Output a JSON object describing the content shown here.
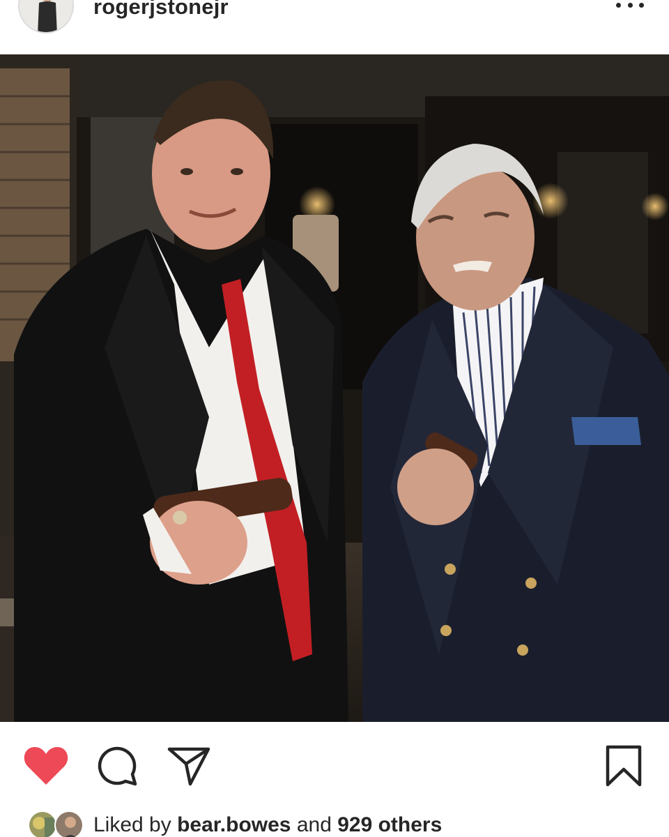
{
  "header": {
    "username": "rogerjstonejr",
    "more_icon": "more-horizontal-icon"
  },
  "photo": {
    "kind": "photo"
  },
  "actions": {
    "like_icon": "heart-filled-icon",
    "like_color": "#ed4956",
    "comment_icon": "comment-icon",
    "share_icon": "paper-plane-icon",
    "save_icon": "bookmark-icon"
  },
  "likes": {
    "prefix": "Liked by ",
    "first_liker": "bear.bowes",
    "connector": " and ",
    "others": "929 others"
  }
}
